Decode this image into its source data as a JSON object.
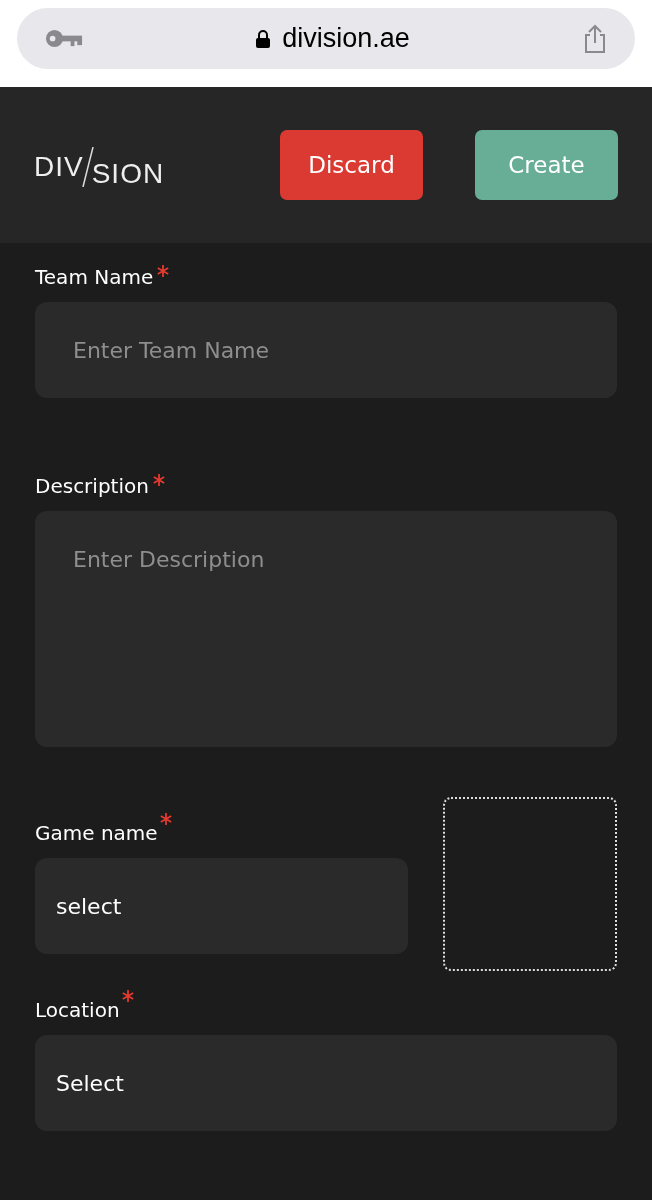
{
  "browser": {
    "url": "division.ae",
    "secure": true
  },
  "header": {
    "logo": {
      "left": "DIV",
      "right": "SION"
    },
    "buttons": [
      {
        "label": "Discard",
        "kind": "danger"
      },
      {
        "label": "Create",
        "kind": "primary"
      }
    ]
  },
  "fields": [
    {
      "label": "Team Name",
      "required": true,
      "kind": "input",
      "placeholder": "Enter Team Name"
    },
    {
      "label": "Description",
      "required": true,
      "kind": "textarea",
      "placeholder": "Enter Description"
    },
    {
      "label": "Game name",
      "required": true,
      "kind": "select",
      "value": "select",
      "image_slot": true
    },
    {
      "label": "Location",
      "required": true,
      "kind": "select",
      "value": "Select"
    }
  ]
}
